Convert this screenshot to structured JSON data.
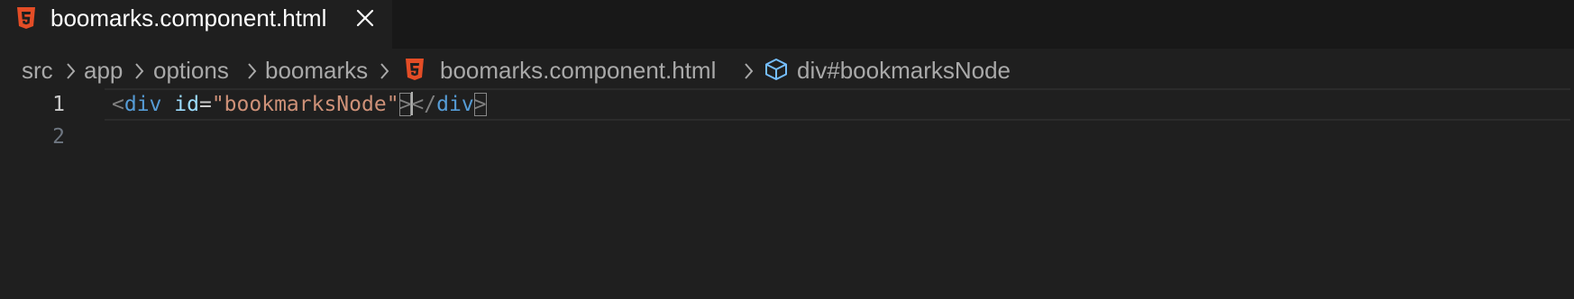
{
  "tab": {
    "label": "boomarks.component.html",
    "icon": "html5-file-icon",
    "close_icon": "close-icon"
  },
  "breadcrumbs": {
    "items": [
      {
        "label": "src"
      },
      {
        "label": "app"
      },
      {
        "label": "options"
      },
      {
        "label": "boomarks"
      },
      {
        "label": "boomarks.component.html",
        "icon": "html5-file-icon"
      },
      {
        "label": "div#bookmarksNode",
        "icon": "cube-symbol-icon"
      }
    ]
  },
  "editor": {
    "line_numbers": [
      "1",
      "2"
    ],
    "active_line": "1",
    "code": {
      "open_angle": "<",
      "tag_name": "div",
      "attr_name": "id",
      "equals": "=",
      "attr_value": "\"bookmarksNode\"",
      "close_angle": ">",
      "close_open_angle": "<",
      "close_slash": "/",
      "close_tag_name": "div",
      "close_close_angle": ">"
    }
  },
  "colors": {
    "background": "#1f1f1f",
    "tabbar_background": "#181818",
    "html_icon": "#e44d26",
    "tag": "#569cd6",
    "attribute": "#9cdcfe",
    "string": "#ce9178",
    "punctuation": "#808080",
    "symbol_icon": "#75beff"
  }
}
